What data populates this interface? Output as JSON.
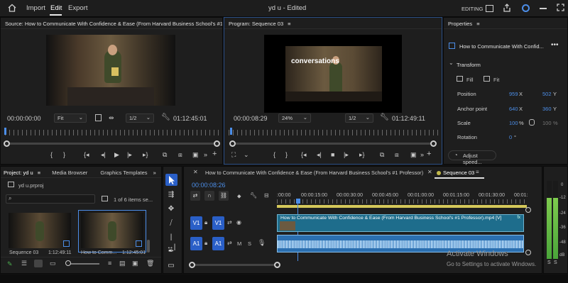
{
  "menu": {
    "import": "Import",
    "edit": "Edit",
    "export": "Export"
  },
  "title": "yd u - Edited",
  "workspace": "EDITING",
  "source": {
    "tab": "Source: How to Communicate With Confidence & Ease (From Harvard Business School's #1 Prof",
    "timecode": "00:00:00:00",
    "fit": "Fit",
    "res": "1/2",
    "duration": "01:12:45:01"
  },
  "program": {
    "tab": "Program: Sequence 03",
    "timecode": "00:00:08:29",
    "zoom": "24%",
    "res": "1/2",
    "duration": "01:12:49:11",
    "overlay_text": "conversations"
  },
  "properties": {
    "title": "Properties",
    "clip": "How to Communicate With Confid...",
    "section": "Transform",
    "fill": "Fill",
    "fit": "Fit",
    "rows": [
      {
        "label": "Position",
        "v1": "959",
        "u1": "X",
        "v2": "502",
        "u2": "Y"
      },
      {
        "label": "Anchor point",
        "v1": "640",
        "u1": "X",
        "v2": "360",
        "u2": "Y"
      },
      {
        "label": "Scale",
        "v1": "100",
        "u1": "%",
        "v2": "100",
        "u2": "%"
      },
      {
        "label": "Rotation",
        "v1": "0",
        "u1": "°",
        "v2": "",
        "u2": ""
      }
    ],
    "adjust_speed": "Adjust speed..."
  },
  "project": {
    "tabs": [
      "Project: yd u",
      "Media Browser",
      "Graphics Templates"
    ],
    "file": "yd u.prproj",
    "count": "1 of 6 items se...",
    "thumbs": [
      {
        "name": "Sequence 03",
        "duration": "1:12:49:11"
      },
      {
        "name": "How to Comm...",
        "duration": "1:12:45:01"
      }
    ]
  },
  "timeline": {
    "tab1": "How to Communicate With Confidence & Ease (From Harvard Business School's #1 Professor)",
    "tab2": "Sequence 03",
    "timecode": "00:00:08:26",
    "ruler": [
      ":00:00",
      "00:00:15:00",
      "00:00:30:00",
      "00:00:45:00",
      "00:01:00:00",
      "00:01:15:00",
      "00:01:30:00",
      "00:01:"
    ],
    "v_clip": "How to Communicate With Confidence & Ease (From Harvard Business School's #1 Professor).mp4 [V]",
    "v_label": "V1",
    "a_label": "A1",
    "m": "M",
    "s": "S"
  },
  "meter": {
    "scale": [
      "0",
      "-12",
      "-24",
      "-36",
      "-48",
      "dB"
    ],
    "s1": "S",
    "s2": "S"
  },
  "watermark": {
    "line1": "Activate Windows",
    "line2": "Go to Settings to activate Windows."
  },
  "colors": {
    "accent": "#4c8ee8",
    "clip": "#1e6d8c",
    "audio": "#2b6fb0",
    "panel": "#1e1e1e"
  }
}
